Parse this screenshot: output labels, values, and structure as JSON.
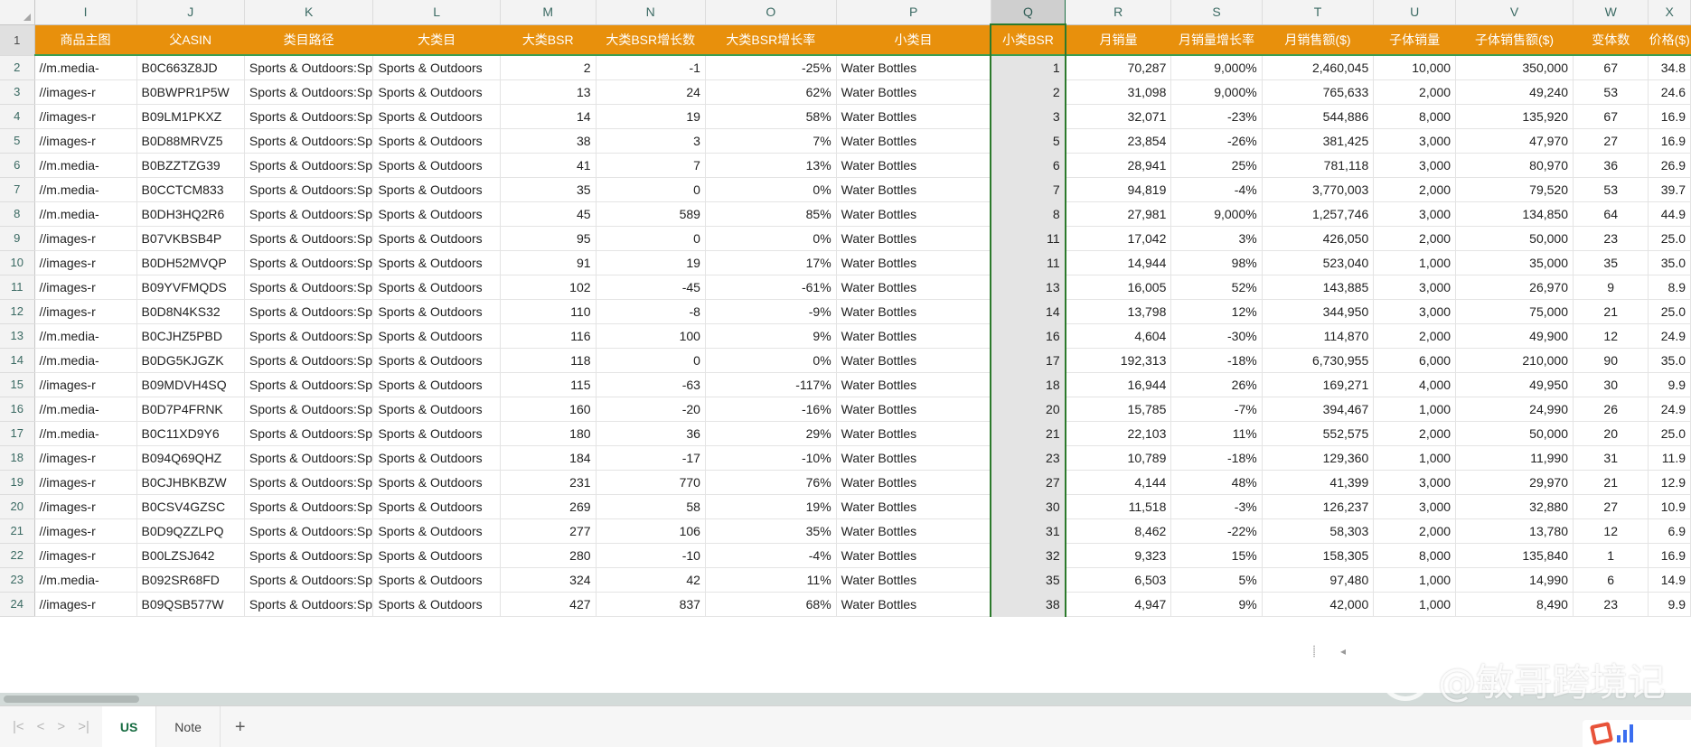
{
  "spreadsheet": {
    "column_letters": [
      "I",
      "J",
      "K",
      "L",
      "M",
      "N",
      "O",
      "P",
      "Q",
      "R",
      "S",
      "T",
      "U",
      "V",
      "W",
      "X"
    ],
    "selected_column": "Q",
    "headers": {
      "I": "商品主图",
      "J": "父ASIN",
      "K": "类目路径",
      "L": "大类目",
      "M": "大类BSR",
      "N": "大类BSR增长数",
      "O": "大类BSR增长率",
      "P": "小类目",
      "Q": "小类BSR",
      "R": "月销量",
      "S": "月销量增长率",
      "T": "月销售额($)",
      "U": "子体销量",
      "V": "子体销售额($)",
      "W": "变体数",
      "X": "价格($)"
    },
    "rows": [
      {
        "n": 2,
        "I": "//m.media-",
        "J": "B0C663Z8JD",
        "K": "Sports & Outdoors:Spor",
        "L": "Sports & Outdoors",
        "M": "2",
        "N": "-1",
        "O": "-25%",
        "P": "Water Bottles",
        "Q": "1",
        "R": "70,287",
        "S": "9,000%",
        "T": "2,460,045",
        "U": "10,000",
        "V": "350,000",
        "W": "67",
        "X": "34.8"
      },
      {
        "n": 3,
        "I": "//images-r",
        "J": "B0BWPR1P5W",
        "K": "Sports & Outdoors:Spor",
        "L": "Sports & Outdoors",
        "M": "13",
        "N": "24",
        "O": "62%",
        "P": "Water Bottles",
        "Q": "2",
        "R": "31,098",
        "S": "9,000%",
        "T": "765,633",
        "U": "2,000",
        "V": "49,240",
        "W": "53",
        "X": "24.6"
      },
      {
        "n": 4,
        "I": "//images-r",
        "J": "B09LM1PKXZ",
        "K": "Sports & Outdoors:Spor",
        "L": "Sports & Outdoors",
        "M": "14",
        "N": "19",
        "O": "58%",
        "P": "Water Bottles",
        "Q": "3",
        "R": "32,071",
        "S": "-23%",
        "T": "544,886",
        "U": "8,000",
        "V": "135,920",
        "W": "67",
        "X": "16.9"
      },
      {
        "n": 5,
        "I": "//images-r",
        "J": "B0D88MRVZ5",
        "K": "Sports & Outdoors:Spor",
        "L": "Sports & Outdoors",
        "M": "38",
        "N": "3",
        "O": "7%",
        "P": "Water Bottles",
        "Q": "5",
        "R": "23,854",
        "S": "-26%",
        "T": "381,425",
        "U": "3,000",
        "V": "47,970",
        "W": "27",
        "X": "16.9"
      },
      {
        "n": 6,
        "I": "//m.media-",
        "J": "B0BZZTZG39",
        "K": "Sports & Outdoors:Spor",
        "L": "Sports & Outdoors",
        "M": "41",
        "N": "7",
        "O": "13%",
        "P": "Water Bottles",
        "Q": "6",
        "R": "28,941",
        "S": "25%",
        "T": "781,118",
        "U": "3,000",
        "V": "80,970",
        "W": "36",
        "X": "26.9"
      },
      {
        "n": 7,
        "I": "//m.media-",
        "J": "B0CCTCM833",
        "K": "Sports & Outdoors:Spor",
        "L": "Sports & Outdoors",
        "M": "35",
        "N": "0",
        "O": "0%",
        "P": "Water Bottles",
        "Q": "7",
        "R": "94,819",
        "S": "-4%",
        "T": "3,770,003",
        "U": "2,000",
        "V": "79,520",
        "W": "53",
        "X": "39.7"
      },
      {
        "n": 8,
        "I": "//m.media-",
        "J": "B0DH3HQ2R6",
        "K": "Sports & Outdoors:Spor",
        "L": "Sports & Outdoors",
        "M": "45",
        "N": "589",
        "O": "85%",
        "P": "Water Bottles",
        "Q": "8",
        "R": "27,981",
        "S": "9,000%",
        "T": "1,257,746",
        "U": "3,000",
        "V": "134,850",
        "W": "64",
        "X": "44.9"
      },
      {
        "n": 9,
        "I": "//images-r",
        "J": "B07VKBSB4P",
        "K": "Sports & Outdoors:Spor",
        "L": "Sports & Outdoors",
        "M": "95",
        "N": "0",
        "O": "0%",
        "P": "Water Bottles",
        "Q": "11",
        "R": "17,042",
        "S": "3%",
        "T": "426,050",
        "U": "2,000",
        "V": "50,000",
        "W": "23",
        "X": "25.0"
      },
      {
        "n": 10,
        "I": "//images-r",
        "J": "B0DH52MVQP",
        "K": "Sports & Outdoors:Spor",
        "L": "Sports & Outdoors",
        "M": "91",
        "N": "19",
        "O": "17%",
        "P": "Water Bottles",
        "Q": "11",
        "R": "14,944",
        "S": "98%",
        "T": "523,040",
        "U": "1,000",
        "V": "35,000",
        "W": "35",
        "X": "35.0"
      },
      {
        "n": 11,
        "I": "//images-r",
        "J": "B09YVFMQDS",
        "K": "Sports & Outdoors:Spor",
        "L": "Sports & Outdoors",
        "M": "102",
        "N": "-45",
        "O": "-61%",
        "P": "Water Bottles",
        "Q": "13",
        "R": "16,005",
        "S": "52%",
        "T": "143,885",
        "U": "3,000",
        "V": "26,970",
        "W": "9",
        "X": "8.9"
      },
      {
        "n": 12,
        "I": "//images-r",
        "J": "B0D8N4KS32",
        "K": "Sports & Outdoors:Spor",
        "L": "Sports & Outdoors",
        "M": "110",
        "N": "-8",
        "O": "-9%",
        "P": "Water Bottles",
        "Q": "14",
        "R": "13,798",
        "S": "12%",
        "T": "344,950",
        "U": "3,000",
        "V": "75,000",
        "W": "21",
        "X": "25.0"
      },
      {
        "n": 13,
        "I": "//m.media-",
        "J": "B0CJHZ5PBD",
        "K": "Sports & Outdoors:Spor",
        "L": "Sports & Outdoors",
        "M": "116",
        "N": "100",
        "O": "9%",
        "P": "Water Bottles",
        "Q": "16",
        "R": "4,604",
        "S": "-30%",
        "T": "114,870",
        "U": "2,000",
        "V": "49,900",
        "W": "12",
        "X": "24.9"
      },
      {
        "n": 14,
        "I": "//m.media-",
        "J": "B0DG5KJGZK",
        "K": "Sports & Outdoors:Spor",
        "L": "Sports & Outdoors",
        "M": "118",
        "N": "0",
        "O": "0%",
        "P": "Water Bottles",
        "Q": "17",
        "R": "192,313",
        "S": "-18%",
        "T": "6,730,955",
        "U": "6,000",
        "V": "210,000",
        "W": "90",
        "X": "35.0"
      },
      {
        "n": 15,
        "I": "//images-r",
        "J": "B09MDVH4SQ",
        "K": "Sports & Outdoors:Spor",
        "L": "Sports & Outdoors",
        "M": "115",
        "N": "-63",
        "O": "-117%",
        "P": "Water Bottles",
        "Q": "18",
        "R": "16,944",
        "S": "26%",
        "T": "169,271",
        "U": "4,000",
        "V": "49,950",
        "W": "30",
        "X": "9.9"
      },
      {
        "n": 16,
        "I": "//m.media-",
        "J": "B0D7P4FRNK",
        "K": "Sports & Outdoors:Spor",
        "L": "Sports & Outdoors",
        "M": "160",
        "N": "-20",
        "O": "-16%",
        "P": "Water Bottles",
        "Q": "20",
        "R": "15,785",
        "S": "-7%",
        "T": "394,467",
        "U": "1,000",
        "V": "24,990",
        "W": "26",
        "X": "24.9"
      },
      {
        "n": 17,
        "I": "//m.media-",
        "J": "B0C11XD9Y6",
        "K": "Sports & Outdoors:Spor",
        "L": "Sports & Outdoors",
        "M": "180",
        "N": "36",
        "O": "29%",
        "P": "Water Bottles",
        "Q": "21",
        "R": "22,103",
        "S": "11%",
        "T": "552,575",
        "U": "2,000",
        "V": "50,000",
        "W": "20",
        "X": "25.0"
      },
      {
        "n": 18,
        "I": "//images-r",
        "J": "B094Q69QHZ",
        "K": "Sports & Outdoors:Spor",
        "L": "Sports & Outdoors",
        "M": "184",
        "N": "-17",
        "O": "-10%",
        "P": "Water Bottles",
        "Q": "23",
        "R": "10,789",
        "S": "-18%",
        "T": "129,360",
        "U": "1,000",
        "V": "11,990",
        "W": "31",
        "X": "11.9"
      },
      {
        "n": 19,
        "I": "//images-r",
        "J": "B0CJHBKBZW",
        "K": "Sports & Outdoors:Spor",
        "L": "Sports & Outdoors",
        "M": "231",
        "N": "770",
        "O": "76%",
        "P": "Water Bottles",
        "Q": "27",
        "R": "4,144",
        "S": "48%",
        "T": "41,399",
        "U": "3,000",
        "V": "29,970",
        "W": "21",
        "X": "12.9"
      },
      {
        "n": 20,
        "I": "//images-r",
        "J": "B0CSV4GZSC",
        "K": "Sports & Outdoors:Spor",
        "L": "Sports & Outdoors",
        "M": "269",
        "N": "58",
        "O": "19%",
        "P": "Water Bottles",
        "Q": "30",
        "R": "11,518",
        "S": "-3%",
        "T": "126,237",
        "U": "3,000",
        "V": "32,880",
        "W": "27",
        "X": "10.9"
      },
      {
        "n": 21,
        "I": "//images-r",
        "J": "B0D9QZZLPQ",
        "K": "Sports & Outdoors:Spor",
        "L": "Sports & Outdoors",
        "M": "277",
        "N": "106",
        "O": "35%",
        "P": "Water Bottles",
        "Q": "31",
        "R": "8,462",
        "S": "-22%",
        "T": "58,303",
        "U": "2,000",
        "V": "13,780",
        "W": "12",
        "X": "6.9"
      },
      {
        "n": 22,
        "I": "//images-r",
        "J": "B00LZSJ642",
        "K": "Sports & Outdoors:Spor",
        "L": "Sports & Outdoors",
        "M": "280",
        "N": "-10",
        "O": "-4%",
        "P": "Water Bottles",
        "Q": "32",
        "R": "9,323",
        "S": "15%",
        "T": "158,305",
        "U": "8,000",
        "V": "135,840",
        "W": "1",
        "X": "16.9"
      },
      {
        "n": 23,
        "I": "//m.media-",
        "J": "B092SR68FD",
        "K": "Sports & Outdoors:Spor",
        "L": "Sports & Outdoors",
        "M": "324",
        "N": "42",
        "O": "11%",
        "P": "Water Bottles",
        "Q": "35",
        "R": "6,503",
        "S": "5%",
        "T": "97,480",
        "U": "1,000",
        "V": "14,990",
        "W": "6",
        "X": "14.9"
      },
      {
        "n": 24,
        "I": "//images-r",
        "J": "B09QSB577W",
        "K": "Sports & Outdoors:Spor",
        "L": "Sports & Outdoors",
        "M": "427",
        "N": "837",
        "O": "68%",
        "P": "Water Bottles",
        "Q": "38",
        "R": "4,947",
        "S": "9%",
        "T": "42,000",
        "U": "1,000",
        "V": "8,490",
        "W": "23",
        "X": "9.9"
      }
    ]
  },
  "sheet_tabs": {
    "first_label": "|<",
    "prev_label": "<",
    "next_label": ">",
    "last_label": ">|",
    "tabs": [
      {
        "label": "US",
        "active": true
      },
      {
        "label": "Note",
        "active": false
      }
    ],
    "add_label": "+"
  },
  "scroll_marks": "⸽ ◂",
  "watermark": {
    "text": "@敏哥跨境记"
  },
  "colors": {
    "header_banner": "#e8900c",
    "selection_border": "#2c7a2c",
    "selection_fill": "#e4e4e4",
    "active_tab_text": "#166b40"
  }
}
